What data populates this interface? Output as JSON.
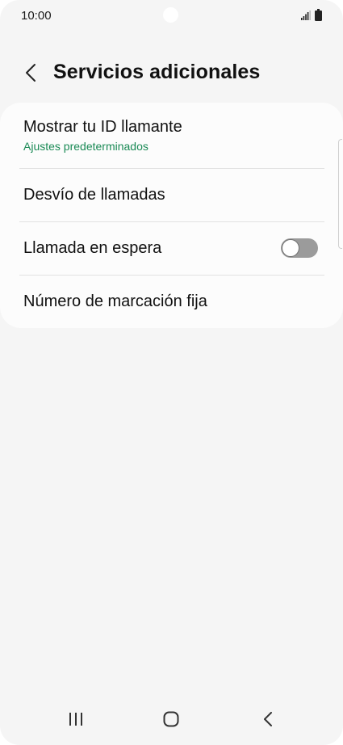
{
  "status_bar": {
    "time": "10:00",
    "icons": [
      "signal-icon",
      "battery-icon"
    ]
  },
  "header": {
    "back_icon": "chevron-left-icon",
    "title": "Servicios adicionales"
  },
  "settings": {
    "caller_id": {
      "title": "Mostrar tu ID llamante",
      "subtitle": "Ajustes predeterminados"
    },
    "call_forwarding": {
      "title": "Desvío de llamadas"
    },
    "call_waiting": {
      "title": "Llamada en espera",
      "toggle_on": false
    },
    "fixed_dialing": {
      "title": "Número de marcación fija"
    }
  },
  "nav_bar": {
    "icons": [
      "recent-apps-icon",
      "home-icon",
      "back-icon"
    ]
  },
  "colors": {
    "accent_subtitle": "#1a8a55",
    "background": "#f5f5f5",
    "card": "#fcfcfc",
    "toggle_off": "#9b9b9b"
  }
}
